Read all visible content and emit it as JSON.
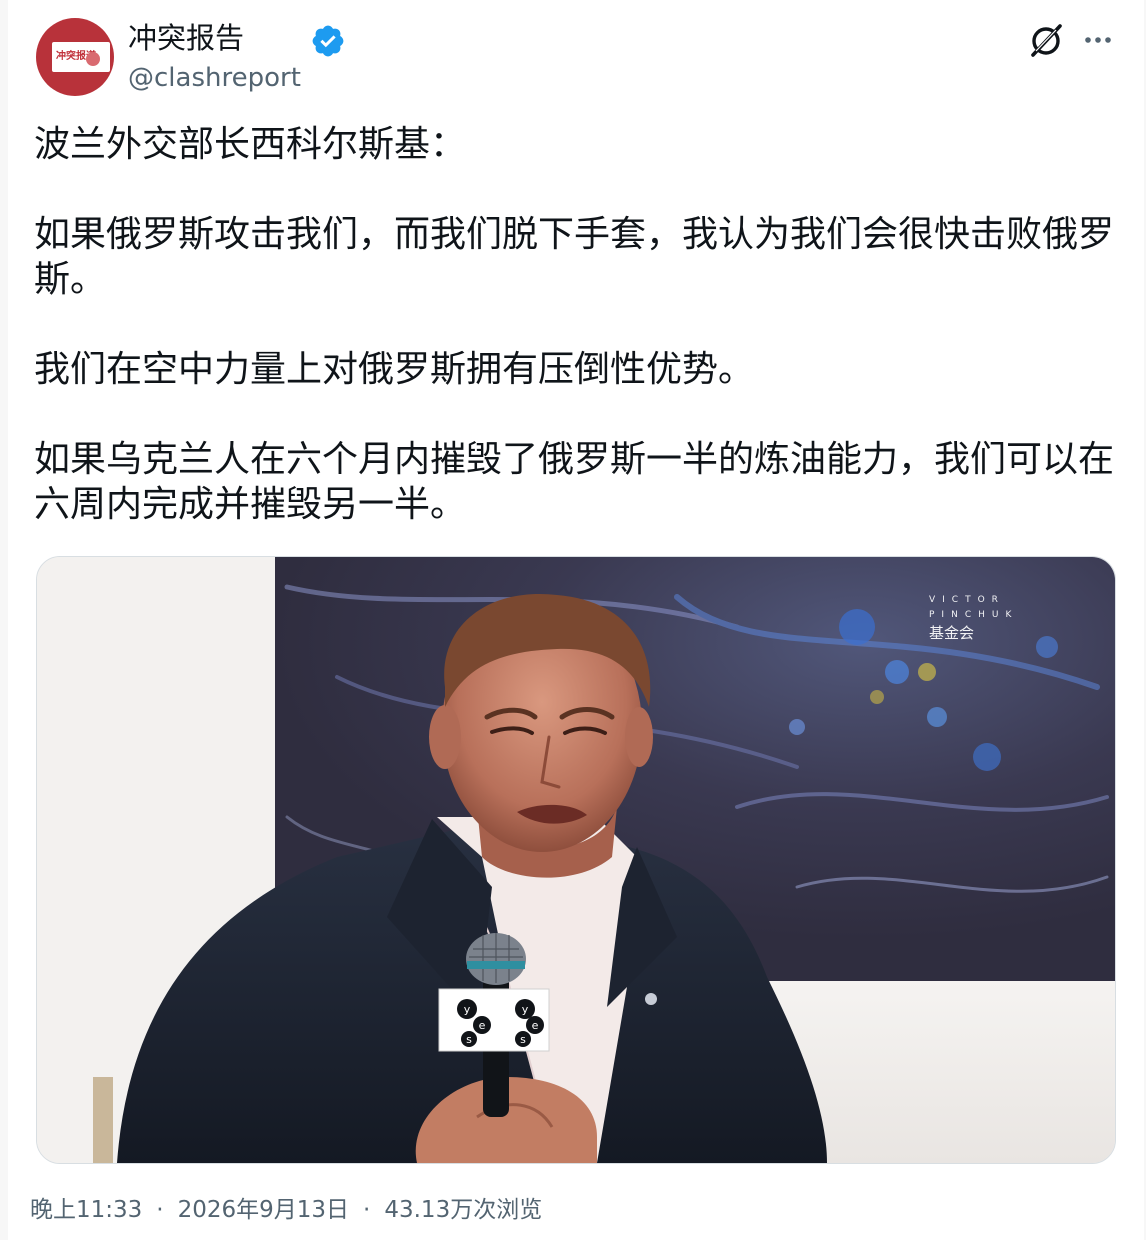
{
  "author": {
    "display_name": "冲突报告",
    "handle": "@clashreport",
    "avatar_text": "冲突报道",
    "verified_icon": "verified-badge-icon",
    "accent_color": "#1d9bf0"
  },
  "header_icons": {
    "grok": "grok-icon",
    "more": "more-options-icon"
  },
  "tweet": {
    "paragraphs": [
      "波兰外交部长西科尔斯基：",
      "如果俄罗斯攻击我们，而我们脱下手套，我认为我们会很快击败俄罗斯。",
      "我们在空中力量上对俄罗斯拥有压倒性优势。",
      "如果乌克兰人在六个月内摧毁了俄罗斯一半的炼油能力，我们可以在六周内完成并摧毁另一半。"
    ]
  },
  "media": {
    "watermark_line1": "VICTOR",
    "watermark_line2": "PINCHUK",
    "watermark_line3": "基金会",
    "mic_logo": "yes"
  },
  "footer": {
    "time": "晚上11:33",
    "separator": "·",
    "date": "2026年9月13日",
    "views": "43.13万次浏览"
  }
}
